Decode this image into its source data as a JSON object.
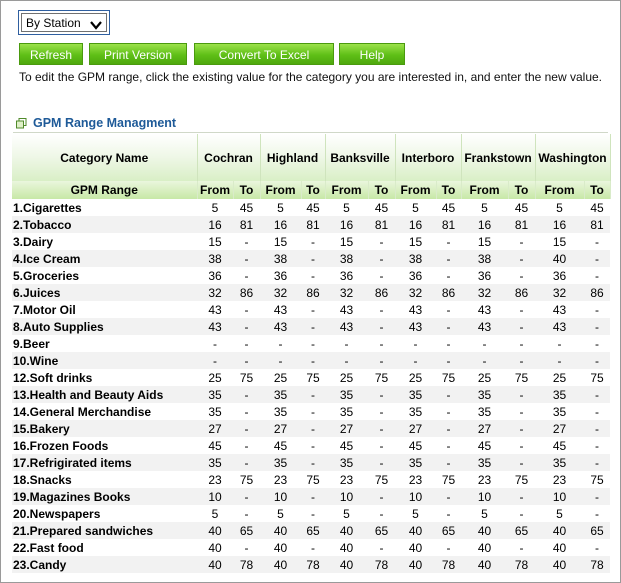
{
  "filter": {
    "selected": "By Station"
  },
  "buttons": {
    "refresh": "Refresh",
    "print": "Print Version",
    "excel": "Convert To Excel",
    "help": "Help"
  },
  "instructions": "To edit the GPM range, click the existing value for the category you are interested in, and enter the new value.",
  "section_title": "GPM Range Managment",
  "table": {
    "category_header": "Category Name",
    "range_header": "GPM Range",
    "from_label": "From",
    "to_label": "To",
    "stations": [
      "Cochran",
      "Highland",
      "Banksville",
      "Interboro",
      "Frankstown",
      "Washington"
    ],
    "rows": [
      {
        "name": "1.Cigarettes",
        "values": [
          "5",
          "45",
          "5",
          "45",
          "5",
          "45",
          "5",
          "45",
          "5",
          "45",
          "5",
          "45"
        ]
      },
      {
        "name": "2.Tobacco",
        "values": [
          "16",
          "81",
          "16",
          "81",
          "16",
          "81",
          "16",
          "81",
          "16",
          "81",
          "16",
          "81"
        ]
      },
      {
        "name": "3.Dairy",
        "values": [
          "15",
          "-",
          "15",
          "-",
          "15",
          "-",
          "15",
          "-",
          "15",
          "-",
          "15",
          "-"
        ]
      },
      {
        "name": "4.Ice Cream",
        "values": [
          "38",
          "-",
          "38",
          "-",
          "38",
          "-",
          "38",
          "-",
          "38",
          "-",
          "40",
          "-"
        ]
      },
      {
        "name": "5.Groceries",
        "values": [
          "36",
          "-",
          "36",
          "-",
          "36",
          "-",
          "36",
          "-",
          "36",
          "-",
          "36",
          "-"
        ]
      },
      {
        "name": "6.Juices",
        "values": [
          "32",
          "86",
          "32",
          "86",
          "32",
          "86",
          "32",
          "86",
          "32",
          "86",
          "32",
          "86"
        ]
      },
      {
        "name": "7.Motor Oil",
        "values": [
          "43",
          "-",
          "43",
          "-",
          "43",
          "-",
          "43",
          "-",
          "43",
          "-",
          "43",
          "-"
        ]
      },
      {
        "name": "8.Auto Supplies",
        "values": [
          "43",
          "-",
          "43",
          "-",
          "43",
          "-",
          "43",
          "-",
          "43",
          "-",
          "43",
          "-"
        ]
      },
      {
        "name": "9.Beer",
        "values": [
          "-",
          "-",
          "-",
          "-",
          "-",
          "-",
          "-",
          "-",
          "-",
          "-",
          "-",
          "-"
        ]
      },
      {
        "name": "10.Wine",
        "values": [
          "-",
          "-",
          "-",
          "-",
          "-",
          "-",
          "-",
          "-",
          "-",
          "-",
          "-",
          "-"
        ]
      },
      {
        "name": "12.Soft drinks",
        "values": [
          "25",
          "75",
          "25",
          "75",
          "25",
          "75",
          "25",
          "75",
          "25",
          "75",
          "25",
          "75"
        ]
      },
      {
        "name": "13.Health and Beauty Aids",
        "values": [
          "35",
          "-",
          "35",
          "-",
          "35",
          "-",
          "35",
          "-",
          "35",
          "-",
          "35",
          "-"
        ]
      },
      {
        "name": "14.General Merchandise",
        "values": [
          "35",
          "-",
          "35",
          "-",
          "35",
          "-",
          "35",
          "-",
          "35",
          "-",
          "35",
          "-"
        ]
      },
      {
        "name": "15.Bakery",
        "values": [
          "27",
          "-",
          "27",
          "-",
          "27",
          "-",
          "27",
          "-",
          "27",
          "-",
          "27",
          "-"
        ]
      },
      {
        "name": "16.Frozen Foods",
        "values": [
          "45",
          "-",
          "45",
          "-",
          "45",
          "-",
          "45",
          "-",
          "45",
          "-",
          "45",
          "-"
        ]
      },
      {
        "name": "17.Refrigirated items",
        "values": [
          "35",
          "-",
          "35",
          "-",
          "35",
          "-",
          "35",
          "-",
          "35",
          "-",
          "35",
          "-"
        ]
      },
      {
        "name": "18.Snacks",
        "values": [
          "23",
          "75",
          "23",
          "75",
          "23",
          "75",
          "23",
          "75",
          "23",
          "75",
          "23",
          "75"
        ]
      },
      {
        "name": "19.Magazines Books",
        "values": [
          "10",
          "-",
          "10",
          "-",
          "10",
          "-",
          "10",
          "-",
          "10",
          "-",
          "10",
          "-"
        ]
      },
      {
        "name": "20.Newspapers",
        "values": [
          "5",
          "-",
          "5",
          "-",
          "5",
          "-",
          "5",
          "-",
          "5",
          "-",
          "5",
          "-"
        ]
      },
      {
        "name": "21.Prepared sandwiches",
        "values": [
          "40",
          "65",
          "40",
          "65",
          "40",
          "65",
          "40",
          "65",
          "40",
          "65",
          "40",
          "65"
        ]
      },
      {
        "name": "22.Fast food",
        "values": [
          "40",
          "-",
          "40",
          "-",
          "40",
          "-",
          "40",
          "-",
          "40",
          "-",
          "40",
          "-"
        ]
      },
      {
        "name": "23.Candy",
        "values": [
          "40",
          "78",
          "40",
          "78",
          "40",
          "78",
          "40",
          "78",
          "40",
          "78",
          "40",
          "78"
        ]
      }
    ]
  }
}
